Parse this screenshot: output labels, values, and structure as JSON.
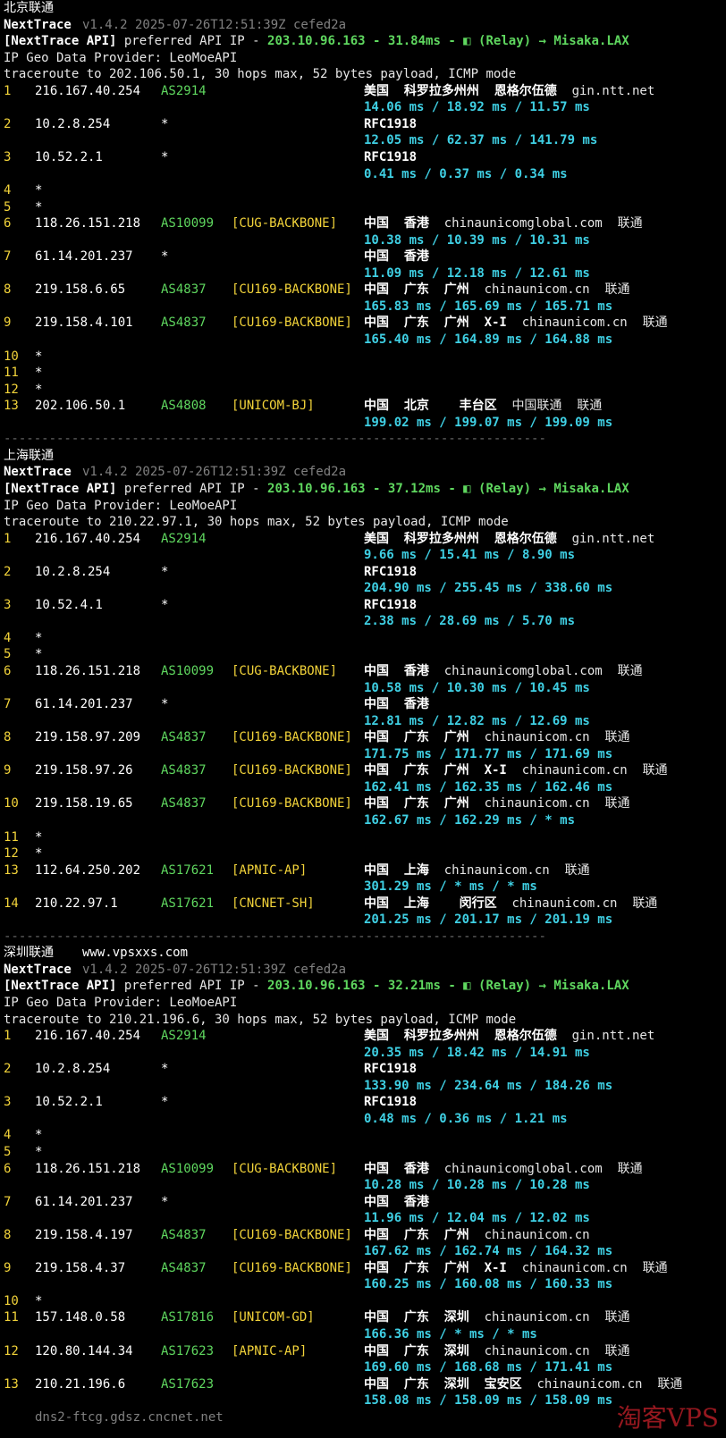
{
  "sections": [
    {
      "id": "bj",
      "title": "北京联通",
      "title_extra": "",
      "app": {
        "name": "NextTrace",
        "version": "v1.4.2 2025-07-26T12:51:39Z cefed2a"
      },
      "api": {
        "prefix": "[NextTrace API]",
        "text": " preferred API IP - ",
        "ip": "203.10.96.163",
        "ms": "- 31.84ms -",
        "relay": "(Relay) → Misaka.LAX",
        "icon": "relay-icon"
      },
      "provider": "IP Geo Data Provider: LeoMoeAPI",
      "traceroute": "traceroute to 202.106.50.1, 30 hops max, 52 bytes payload, ICMP mode",
      "hops": [
        {
          "n": "1",
          "ip": "216.167.40.254",
          "asn": "AS2914",
          "tag": "",
          "geo": "美国  科罗拉多州州  恩格尔伍德",
          "host": "gin.ntt.net",
          "isp": "",
          "times": "14.06 ms / 18.92 ms / 11.57 ms"
        },
        {
          "n": "2",
          "ip": "10.2.8.254",
          "asn": "*",
          "tag": "",
          "geo": "RFC1918",
          "host": "",
          "isp": "",
          "times": "12.05 ms / 62.37 ms / 141.79 ms"
        },
        {
          "n": "3",
          "ip": "10.52.2.1",
          "asn": "*",
          "tag": "",
          "geo": "RFC1918",
          "host": "",
          "isp": "",
          "times": "0.41 ms / 0.37 ms / 0.34 ms"
        },
        {
          "n": "4",
          "ip": "*"
        },
        {
          "n": "5",
          "ip": "*"
        },
        {
          "n": "6",
          "ip": "118.26.151.218",
          "asn": "AS10099",
          "tag": "[CUG-BACKBONE]",
          "geo": "中国  香港",
          "host": "chinaunicomglobal.com",
          "isp": "联通",
          "times": "10.38 ms / 10.39 ms / 10.31 ms"
        },
        {
          "n": "7",
          "ip": "61.14.201.237",
          "asn": "*",
          "tag": "",
          "geo": "中国  香港",
          "host": "",
          "isp": "",
          "times": "11.09 ms / 12.18 ms / 12.61 ms"
        },
        {
          "n": "8",
          "ip": "219.158.6.65",
          "asn": "AS4837",
          "tag": "[CU169-BACKBONE]",
          "geo": "中国  广东  广州",
          "host": "chinaunicom.cn",
          "isp": "联通",
          "times": "165.83 ms / 165.69 ms / 165.71 ms"
        },
        {
          "n": "9",
          "ip": "219.158.4.101",
          "asn": "AS4837",
          "tag": "[CU169-BACKBONE]",
          "geo": "中国  广东  广州  X-I",
          "host": "chinaunicom.cn",
          "isp": "联通",
          "times": "165.40 ms / 164.89 ms / 164.88 ms"
        },
        {
          "n": "10",
          "ip": "*"
        },
        {
          "n": "11",
          "ip": "*"
        },
        {
          "n": "12",
          "ip": "*"
        },
        {
          "n": "13",
          "ip": "202.106.50.1",
          "asn": "AS4808",
          "tag": "[UNICOM-BJ]",
          "geo": "中国  北京    丰台区",
          "host": "中国联通",
          "isp": "联通",
          "times": "199.02 ms / 199.07 ms / 199.09 ms"
        }
      ]
    },
    {
      "id": "sh",
      "title": "上海联通",
      "title_extra": "",
      "app": {
        "name": "NextTrace",
        "version": "v1.4.2 2025-07-26T12:51:39Z cefed2a"
      },
      "api": {
        "prefix": "[NextTrace API]",
        "text": " preferred API IP - ",
        "ip": "203.10.96.163",
        "ms": "- 37.12ms -",
        "relay": "(Relay) → Misaka.LAX",
        "icon": "relay-icon"
      },
      "provider": "IP Geo Data Provider: LeoMoeAPI",
      "traceroute": "traceroute to 210.22.97.1, 30 hops max, 52 bytes payload, ICMP mode",
      "hops": [
        {
          "n": "1",
          "ip": "216.167.40.254",
          "asn": "AS2914",
          "tag": "",
          "geo": "美国  科罗拉多州州  恩格尔伍德",
          "host": "gin.ntt.net",
          "isp": "",
          "times": "9.66 ms / 15.41 ms / 8.90 ms"
        },
        {
          "n": "2",
          "ip": "10.2.8.254",
          "asn": "*",
          "tag": "",
          "geo": "RFC1918",
          "host": "",
          "isp": "",
          "times": "204.90 ms / 255.45 ms / 338.60 ms"
        },
        {
          "n": "3",
          "ip": "10.52.4.1",
          "asn": "*",
          "tag": "",
          "geo": "RFC1918",
          "host": "",
          "isp": "",
          "times": "2.38 ms / 28.69 ms / 5.70 ms"
        },
        {
          "n": "4",
          "ip": "*"
        },
        {
          "n": "5",
          "ip": "*"
        },
        {
          "n": "6",
          "ip": "118.26.151.218",
          "asn": "AS10099",
          "tag": "[CUG-BACKBONE]",
          "geo": "中国  香港",
          "host": "chinaunicomglobal.com",
          "isp": "联通",
          "times": "10.58 ms / 10.30 ms / 10.45 ms"
        },
        {
          "n": "7",
          "ip": "61.14.201.237",
          "asn": "*",
          "tag": "",
          "geo": "中国  香港",
          "host": "",
          "isp": "",
          "times": "12.81 ms / 12.82 ms / 12.69 ms"
        },
        {
          "n": "8",
          "ip": "219.158.97.209",
          "asn": "AS4837",
          "tag": "[CU169-BACKBONE]",
          "geo": "中国  广东  广州",
          "host": "chinaunicom.cn",
          "isp": "联通",
          "times": "171.75 ms / 171.77 ms / 171.69 ms"
        },
        {
          "n": "9",
          "ip": "219.158.97.26",
          "asn": "AS4837",
          "tag": "[CU169-BACKBONE]",
          "geo": "中国  广东  广州  X-I",
          "host": "chinaunicom.cn",
          "isp": "联通",
          "times": "162.41 ms / 162.35 ms / 162.46 ms"
        },
        {
          "n": "10",
          "ip": "219.158.19.65",
          "asn": "AS4837",
          "tag": "[CU169-BACKBONE]",
          "geo": "中国  广东  广州",
          "host": "chinaunicom.cn",
          "isp": "联通",
          "times": "162.67 ms / 162.29 ms / * ms"
        },
        {
          "n": "11",
          "ip": "*"
        },
        {
          "n": "12",
          "ip": "*"
        },
        {
          "n": "13",
          "ip": "112.64.250.202",
          "asn": "AS17621",
          "tag": "[APNIC-AP]",
          "geo": "中国  上海",
          "host": "chinaunicom.cn",
          "isp": "联通",
          "times": "301.29 ms / * ms / * ms"
        },
        {
          "n": "14",
          "ip": "210.22.97.1",
          "asn": "AS17621",
          "tag": "[CNCNET-SH]",
          "geo": "中国  上海    闵行区",
          "host": "chinaunicom.cn",
          "isp": "联通",
          "times": "201.25 ms / 201.17 ms / 201.19 ms"
        }
      ]
    },
    {
      "id": "sz",
      "title": "深圳联通",
      "title_extra": "www.vpsxxs.com",
      "app": {
        "name": "NextTrace",
        "version": "v1.4.2 2025-07-26T12:51:39Z cefed2a"
      },
      "api": {
        "prefix": "[NextTrace API]",
        "text": " preferred API IP - ",
        "ip": "203.10.96.163",
        "ms": "- 32.21ms -",
        "relay": "(Relay) → Misaka.LAX",
        "icon": "relay-icon"
      },
      "provider": "IP Geo Data Provider: LeoMoeAPI",
      "traceroute": "traceroute to 210.21.196.6, 30 hops max, 52 bytes payload, ICMP mode",
      "hops": [
        {
          "n": "1",
          "ip": "216.167.40.254",
          "asn": "AS2914",
          "tag": "",
          "geo": "美国  科罗拉多州州  恩格尔伍德",
          "host": "gin.ntt.net",
          "isp": "",
          "times": "20.35 ms / 18.42 ms / 14.91 ms"
        },
        {
          "n": "2",
          "ip": "10.2.8.254",
          "asn": "*",
          "tag": "",
          "geo": "RFC1918",
          "host": "",
          "isp": "",
          "times": "133.90 ms / 234.64 ms / 184.26 ms"
        },
        {
          "n": "3",
          "ip": "10.52.2.1",
          "asn": "*",
          "tag": "",
          "geo": "RFC1918",
          "host": "",
          "isp": "",
          "times": "0.48 ms / 0.36 ms / 1.21 ms"
        },
        {
          "n": "4",
          "ip": "*"
        },
        {
          "n": "5",
          "ip": "*"
        },
        {
          "n": "6",
          "ip": "118.26.151.218",
          "asn": "AS10099",
          "tag": "[CUG-BACKBONE]",
          "geo": "中国  香港",
          "host": "chinaunicomglobal.com",
          "isp": "联通",
          "times": "10.28 ms / 10.28 ms / 10.28 ms"
        },
        {
          "n": "7",
          "ip": "61.14.201.237",
          "asn": "*",
          "tag": "",
          "geo": "中国  香港",
          "host": "",
          "isp": "",
          "times": "11.96 ms / 12.04 ms / 12.02 ms"
        },
        {
          "n": "8",
          "ip": "219.158.4.197",
          "asn": "AS4837",
          "tag": "[CU169-BACKBONE]",
          "geo": "中国  广东  广州",
          "host": "chinaunicom.cn",
          "isp": "",
          "times": "167.62 ms / 162.74 ms / 164.32 ms"
        },
        {
          "n": "9",
          "ip": "219.158.4.37",
          "asn": "AS4837",
          "tag": "[CU169-BACKBONE]",
          "geo": "中国  广东  广州  X-I",
          "host": "chinaunicom.cn",
          "isp": "联通",
          "times": "160.25 ms / 160.08 ms / 160.33 ms"
        },
        {
          "n": "10",
          "ip": "*"
        },
        {
          "n": "11",
          "ip": "157.148.0.58",
          "asn": "AS17816",
          "tag": "[UNICOM-GD]",
          "geo": "中国  广东  深圳",
          "host": "chinaunicom.cn",
          "isp": "联通",
          "times": "166.36 ms / * ms / * ms"
        },
        {
          "n": "12",
          "ip": "120.80.144.34",
          "asn": "AS17623",
          "tag": "[APNIC-AP]",
          "geo": "中国  广东  深圳",
          "host": "chinaunicom.cn",
          "isp": "联通",
          "times": "169.60 ms / 168.68 ms / 171.41 ms"
        },
        {
          "n": "13",
          "ip": "210.21.196.6",
          "asn": "AS17623",
          "tag": "",
          "geo": "中国  广东  深圳  宝安区",
          "host": "chinaunicom.cn",
          "isp": "联通",
          "times": "158.08 ms / 158.09 ms / 158.09 ms",
          "rdns": "dns2-ftcg.gdsz.cncnet.net"
        }
      ]
    }
  ],
  "separator": "------------------------------------------------------------------------",
  "watermark": "淘客VPS",
  "colors": {
    "background": "#000000",
    "cyan": "#3fd0e4",
    "green": "#5fd75f",
    "yellow": "#f2d33a",
    "dim": "#808080"
  }
}
